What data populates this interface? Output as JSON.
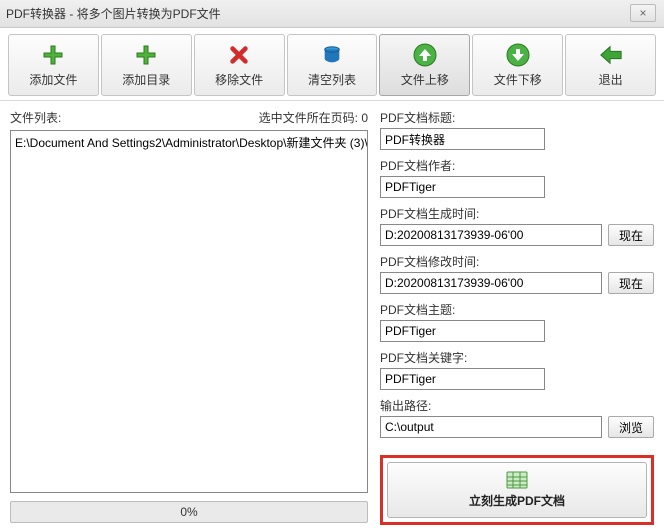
{
  "window": {
    "title": "PDF转换器 - 将多个图片转换为PDF文件",
    "close": "×"
  },
  "toolbar": {
    "addFile": "添加文件",
    "addDir": "添加目录",
    "removeFile": "移除文件",
    "clearList": "清空列表",
    "moveUp": "文件上移",
    "moveDown": "文件下移",
    "exit": "退出"
  },
  "left": {
    "listLabel": "文件列表:",
    "selectedInfo": "选中文件所在页码: 0",
    "items": [
      "E:\\Document And Settings2\\Administrator\\Desktop\\新建文件夹 (3)\\"
    ],
    "progress": "0%"
  },
  "right": {
    "titleLabel": "PDF文档标题:",
    "titleValue": "PDF转换器",
    "authorLabel": "PDF文档作者:",
    "authorValue": "PDFTiger",
    "createdLabel": "PDF文档生成时间:",
    "createdValue": "D:20200813173939-06'00",
    "modifiedLabel": "PDF文档修改时间:",
    "modifiedValue": "D:20200813173939-06'00",
    "subjectLabel": "PDF文档主题:",
    "subjectValue": "PDFTiger",
    "keywordsLabel": "PDF文档关键字:",
    "keywordsValue": "PDFTiger",
    "outputLabel": "输出路径:",
    "outputValue": "C:\\output",
    "nowBtn": "现在",
    "browseBtn": "浏览",
    "generateBtn": "立刻生成PDF文档"
  },
  "colors": {
    "accent": "#35a000",
    "highlight": "#d93025"
  }
}
